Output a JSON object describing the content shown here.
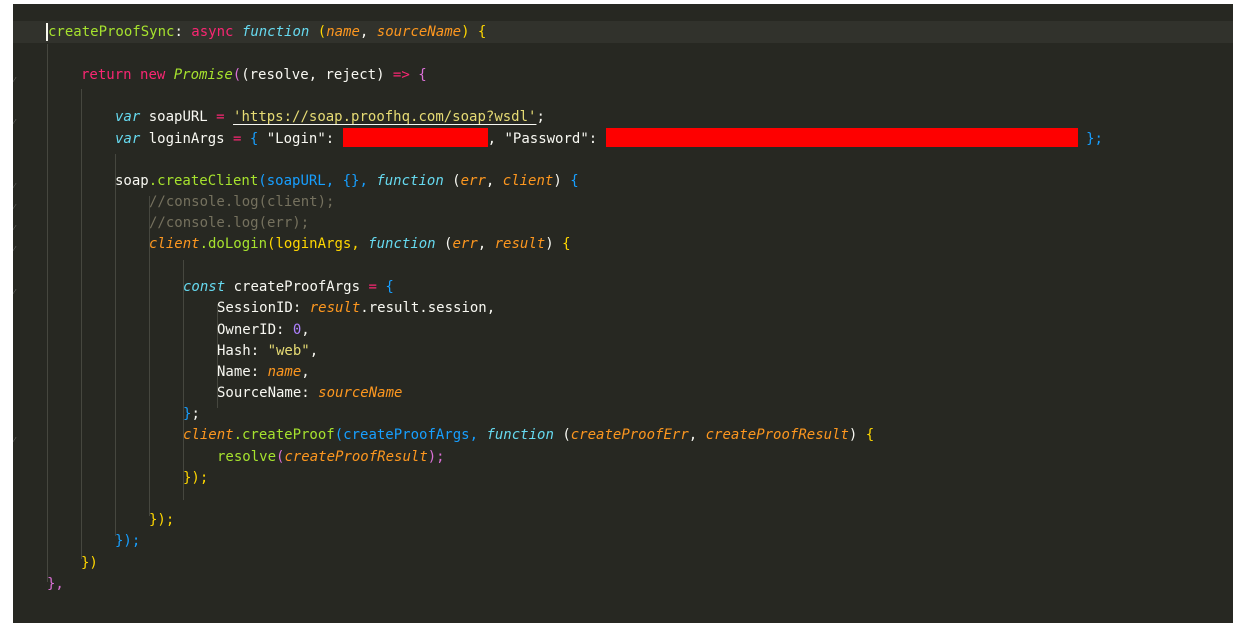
{
  "code": {
    "l1": {
      "name": "createProofSync",
      "colon": ": ",
      "async": "async",
      "function": "function",
      "open": " (",
      "p1": "name",
      "comma": ", ",
      "p2": "sourceName",
      "close": ") ",
      "brace": "{"
    },
    "l3": {
      "return": "return",
      "new": "new",
      "promise": "Promise",
      "open": "(",
      "params": "(resolve, reject)",
      "arrow": " => ",
      "brace": "{"
    },
    "l5": {
      "var": "var",
      "name": " soapURL ",
      "eq": "=",
      "space": " ",
      "url": "'https://soap.proofhq.com/soap?wsdl'",
      "semi": ";"
    },
    "l6": {
      "var": "var",
      "name": " loginArgs ",
      "eq": "=",
      "brace": " { ",
      "login_key": "\"Login\"",
      "colon": ": ",
      "comma": ", ",
      "password_key": "\"Password\"",
      "colon2": ": ",
      "close": " };"
    },
    "l8": {
      "obj": "soap",
      "fn": ".createClient",
      "open": "(soapURL, {}, ",
      "function": "function",
      "popen": " (",
      "p1": "err",
      "comma": ", ",
      "p2": "client",
      "pclose": ") ",
      "brace": "{"
    },
    "l9": {
      "comment": "//console.log(client);"
    },
    "l10": {
      "comment": "//console.log(err);"
    },
    "l11": {
      "obj": "client",
      "fn": ".doLogin",
      "open": "(loginArgs, ",
      "function": "function",
      "popen": " (",
      "p1": "err",
      "comma": ", ",
      "p2": "result",
      "pclose": ") ",
      "brace": "{"
    },
    "l13": {
      "const": "const",
      "name": " createProofArgs ",
      "eq": "=",
      "brace": " {"
    },
    "l14": {
      "key": "SessionID: ",
      "obj": "result",
      "rest": ".result.session,"
    },
    "l15": {
      "key": "OwnerID: ",
      "num": "0",
      "comma": ","
    },
    "l16": {
      "key": "Hash: ",
      "str": "\"web\"",
      "comma": ","
    },
    "l17": {
      "key": "Name: ",
      "val": "name",
      "comma": ","
    },
    "l18": {
      "key": "SourceName: ",
      "val": "sourceName"
    },
    "l19": {
      "brace": "}",
      "semi": ";"
    },
    "l20": {
      "obj": "client",
      "fn": ".createProof",
      "open": "(createProofArgs, ",
      "function": "function",
      "popen": " (",
      "p1": "createProofErr",
      "comma": ", ",
      "p2": "createProofResult",
      "pclose": ") ",
      "brace": "{"
    },
    "l21": {
      "fn": "resolve",
      "open": "(",
      "arg": "createProofResult",
      "close": ");"
    },
    "l22": {
      "close": "});"
    },
    "l24": {
      "close": "});"
    },
    "l25": {
      "close": "});"
    },
    "l26": {
      "close": "})"
    },
    "l27": {
      "close": "},"
    },
    "l29": {
      "text": "  ."
    }
  },
  "colors": {
    "background": "#272822",
    "redaction": "#fe0000",
    "keyword": "#f92672",
    "storage": "#66d9ef",
    "function": "#a6e22e",
    "parameter": "#fd971f",
    "string": "#e6db74",
    "number": "#ae81ff",
    "comment": "#75715e"
  }
}
